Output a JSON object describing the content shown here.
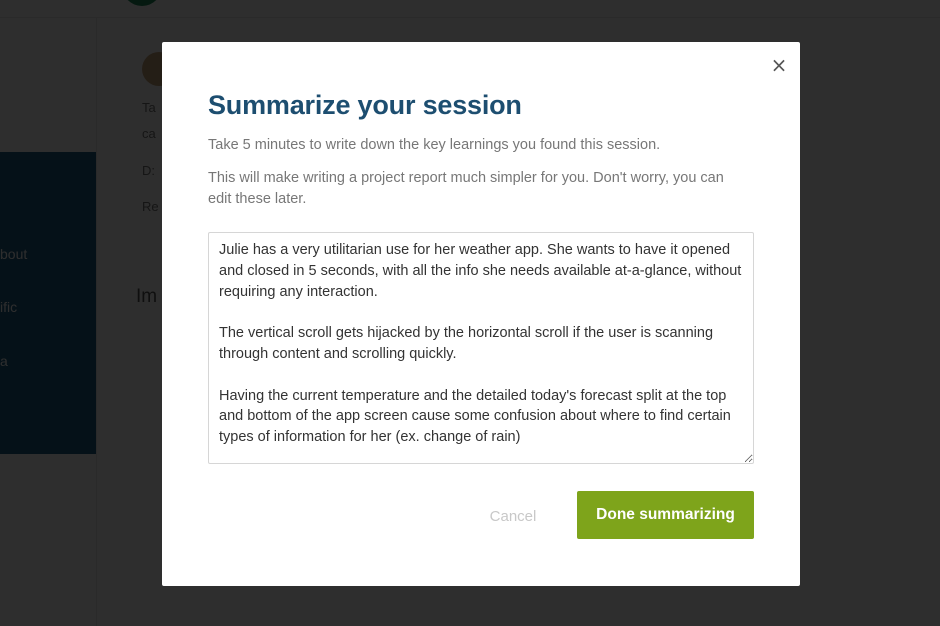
{
  "background": {
    "sidebar_items": [
      "bout",
      "ific",
      "a"
    ],
    "lines": [
      "Ta",
      "ca",
      "D:",
      "Re"
    ],
    "heading": "Im"
  },
  "modal": {
    "close_icon": "×",
    "title": "Summarize your session",
    "description_1": "Take 5 minutes to write down the key learnings you found this session.",
    "description_2": "This will make writing a project report much simpler for you. Don't worry, you can edit these later.",
    "notes_value": "Julie has a very utilitarian use for her weather app. She wants to have it opened and closed in 5 seconds, with all the info she needs available at-a-glance, without requiring any interaction.\n\nThe vertical scroll gets hijacked by the horizontal scroll if the user is scanning through content and scrolling quickly.\n\nHaving the current temperature and the detailed today's forecast split at the top and bottom of the app screen cause some confusion about where to find certain types of information for her (ex. change of rain)",
    "cancel_label": "Cancel",
    "done_label": "Done summarizing"
  },
  "colors": {
    "title": "#1d4e70",
    "primary_button": "#7ea41b",
    "sidebar": "#1f5f86"
  }
}
